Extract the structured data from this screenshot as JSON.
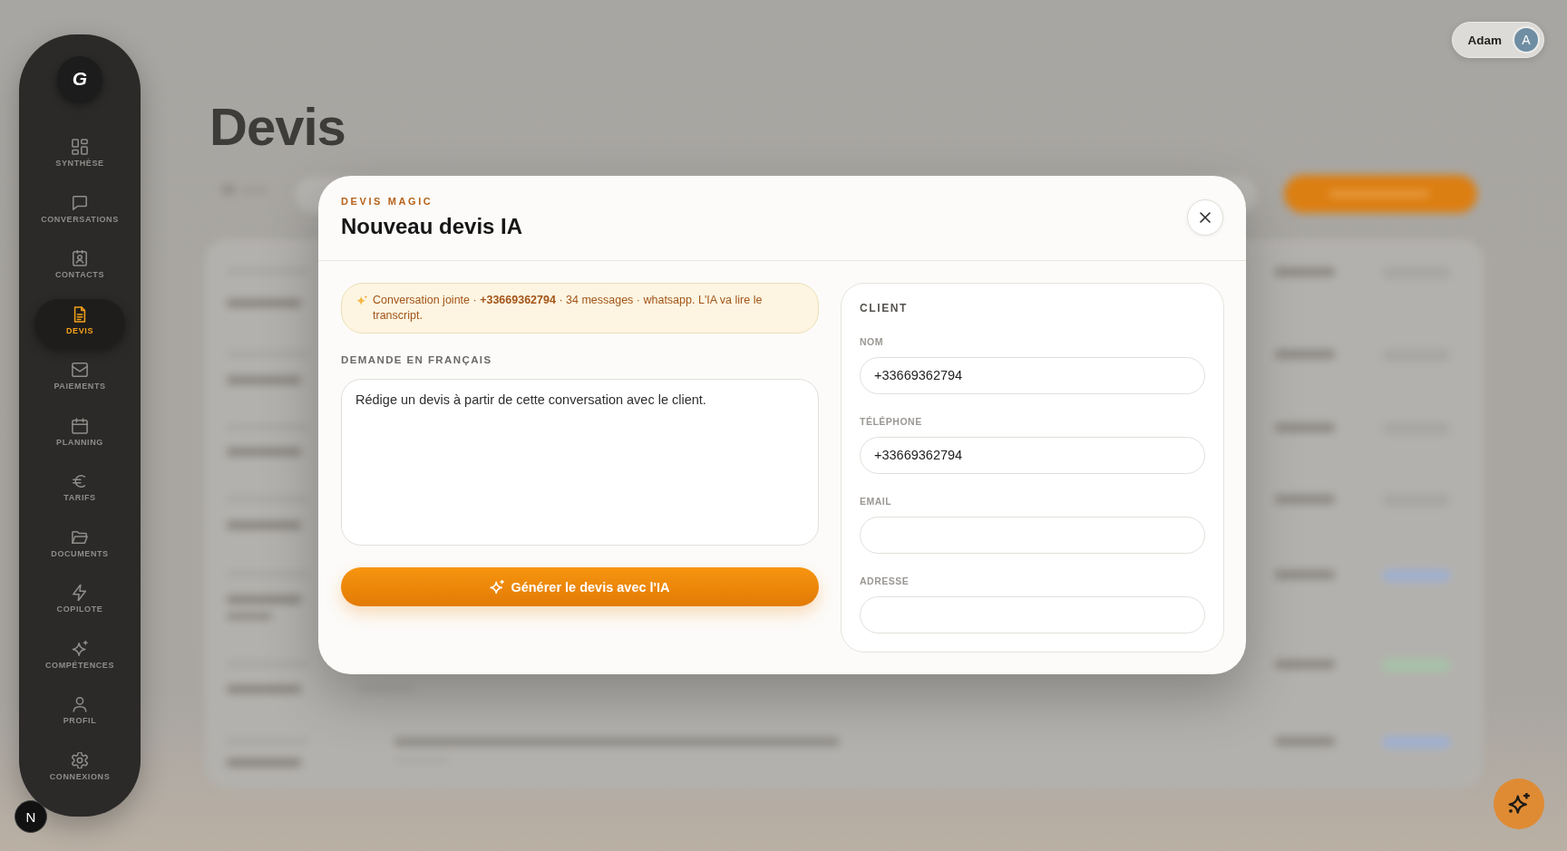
{
  "sidebar": {
    "logo": "G",
    "items": [
      {
        "label": "SYNTHÈSE",
        "kind": "dashboard",
        "selected": false
      },
      {
        "label": "CONVERSATIONS",
        "kind": "chat",
        "selected": false
      },
      {
        "label": "CONTACTS",
        "kind": "contact",
        "selected": false
      },
      {
        "label": "DEVIS",
        "kind": "document",
        "selected": true
      },
      {
        "label": "PAIEMENTS",
        "kind": "inbox",
        "selected": false
      },
      {
        "label": "PLANNING",
        "kind": "calendar",
        "selected": false
      },
      {
        "label": "TARIFS",
        "kind": "euro",
        "selected": false
      },
      {
        "label": "DOCUMENTS",
        "kind": "folder",
        "selected": false
      },
      {
        "label": "COPILOTE",
        "kind": "bolt",
        "selected": false
      },
      {
        "label": "COMPÉTENCES",
        "kind": "sparkles",
        "selected": false
      },
      {
        "label": "PROFIL",
        "kind": "user",
        "selected": false
      },
      {
        "label": "CONNEXIONS",
        "kind": "gear",
        "selected": false
      }
    ]
  },
  "dev_badge": {
    "label": "N"
  },
  "page": {
    "title": "Devis"
  },
  "user_menu": {
    "name": "Adam",
    "avatar_initial": "A"
  },
  "modal": {
    "eyebrow": "DEVIS MAGIC",
    "title": "Nouveau devis IA",
    "banner": "Conversation jointe · **+33669362794** · 34 messages · whatsapp. L'IA va lire le transcript.",
    "request_label": "DEMANDE EN FRANÇAIS",
    "request_value": "Rédige un devis à partir de cette conversation avec le client.",
    "generate_button": "Générer le devis avec l'IA",
    "client": {
      "heading": "CLIENT",
      "fields": [
        {
          "label": "NOM",
          "value": "+33669362794"
        },
        {
          "label": "TÉLÉPHONE",
          "value": "+33669362794"
        },
        {
          "label": "EMAIL"
        },
        {
          "label": "ADRESSE"
        }
      ]
    }
  }
}
